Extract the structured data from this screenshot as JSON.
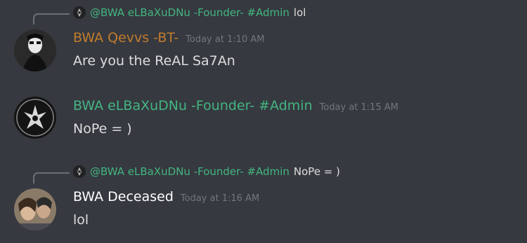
{
  "messages": [
    {
      "reply": {
        "name": "@BWA eLBaXuDNu -Founder- #Admin",
        "text": "lol"
      },
      "author": "BWA Qevvs  -BT-",
      "author_color": "#c27c2e",
      "timestamp": "Today at 1:10 AM",
      "text": "Are you the ReAL Sa7An"
    },
    {
      "author": "BWA eLBaXuDNu -Founder- #Admin",
      "author_color": "#43b581",
      "timestamp": "Today at 1:15 AM",
      "text": "NoPe  = )"
    },
    {
      "reply": {
        "name": "@BWA eLBaXuDNu -Founder- #Admin",
        "text": "NoPe  = )"
      },
      "author": "BWA Deceased",
      "author_color": "#ffffff",
      "timestamp": "Today at 1:16 AM",
      "text": "lol"
    }
  ]
}
